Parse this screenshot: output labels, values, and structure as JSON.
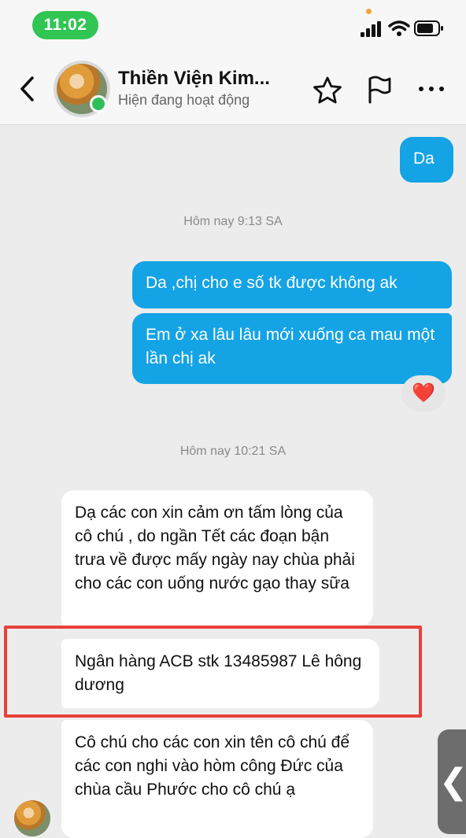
{
  "status_bar": {
    "time": "11:02"
  },
  "header": {
    "contact_name": "Thiền Viện Kim...",
    "contact_status": "Hiện đang hoạt động"
  },
  "messages": {
    "out_1": "Da",
    "timestamp_1": "Hôm nay 9:13 SA",
    "out_2": "Da ,chị cho e số tk được không ak",
    "out_3": "Em ở xa lâu lâu mới xuống ca mau một lần chị ak",
    "reaction": "❤️",
    "timestamp_2": "Hôm nay 10:21 SA",
    "in_1": "Dạ các con xin cảm ơn tấm lòng của cô chú , do ngần Tết các đoạn bận trưa về được mấy ngày nay chùa phải cho các con uống nước gạo thay sữa",
    "in_2": "Ngân hàng ACB stk 13485987 Lê hông dương",
    "in_3": "Cô chú cho các con xin tên cô chú để các con nghi vào hòm công Đức của chùa cầu Phước cho cô chú ạ"
  },
  "side_tab": {
    "glyph": "❮"
  },
  "colors": {
    "outgoing_bubble": "#14a3e4",
    "incoming_bubble": "#ffffff",
    "online": "#2ec05b",
    "highlight": "#e8413a",
    "time_pill": "#31c553"
  }
}
